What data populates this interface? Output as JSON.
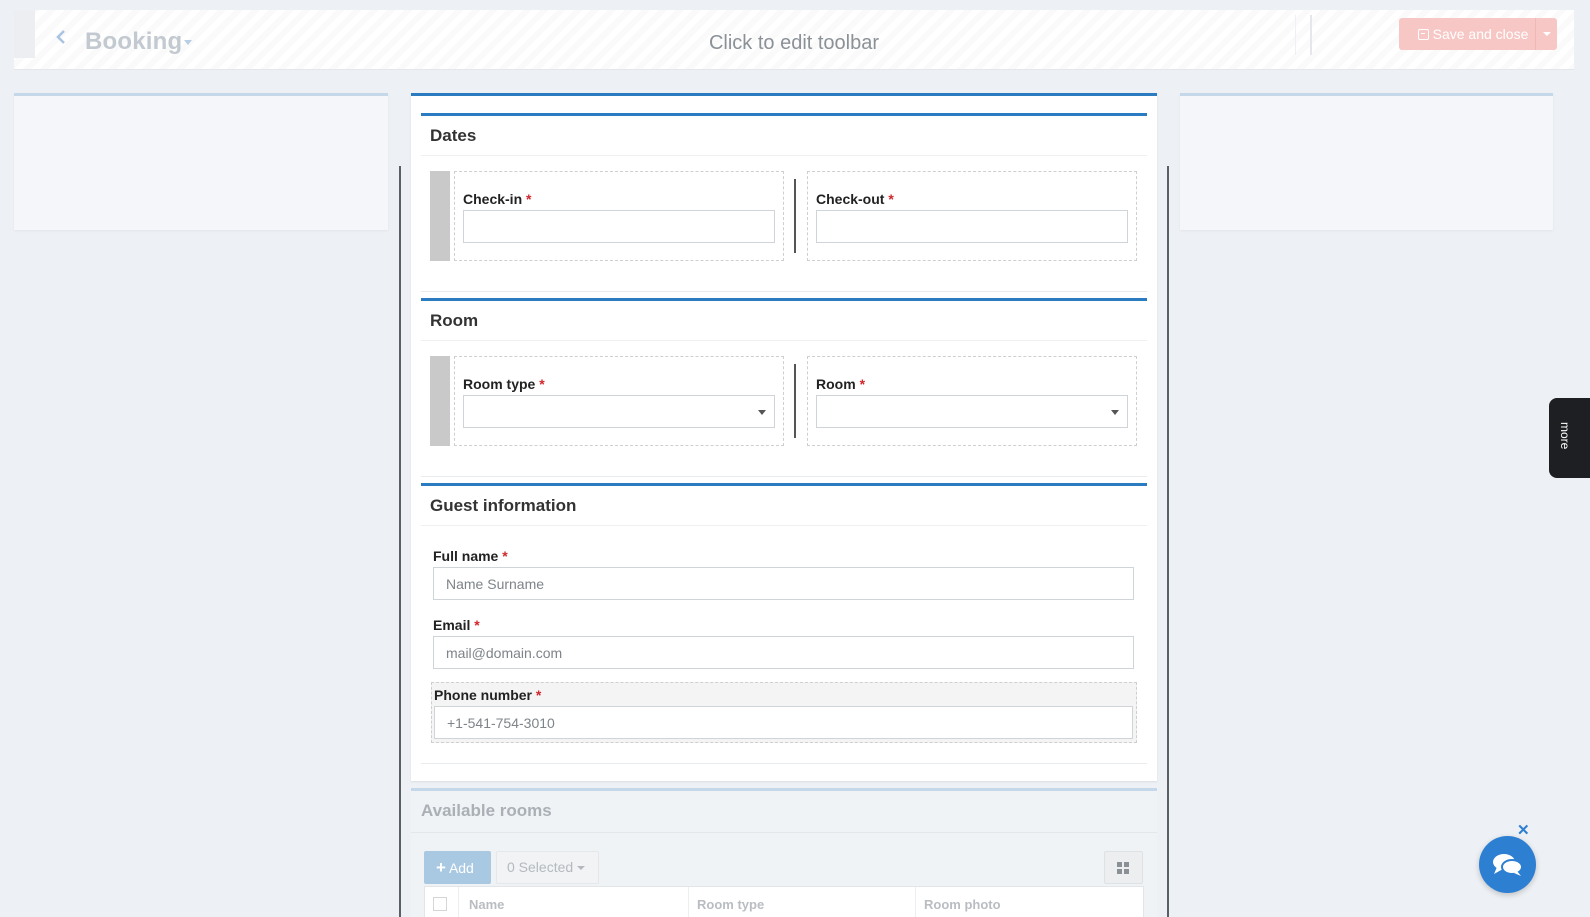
{
  "toolbar": {
    "title": "Booking",
    "center_text": "Click to edit toolbar",
    "save_label": "Save and close"
  },
  "sections": {
    "dates": {
      "title": "Dates",
      "checkin_label": "Check-in",
      "checkout_label": "Check-out",
      "checkin_value": "",
      "checkout_value": ""
    },
    "room": {
      "title": "Room",
      "room_type_label": "Room type",
      "room_label": "Room",
      "room_type_value": "",
      "room_value": ""
    },
    "guest": {
      "title": "Guest information",
      "full_name_label": "Full name",
      "full_name_placeholder": "Name Surname",
      "email_label": "Email",
      "email_placeholder": "mail@domain.com",
      "phone_label": "Phone number",
      "phone_placeholder": "+1-541-754-3010"
    },
    "available_rooms": {
      "title": "Available rooms",
      "add_label": "Add",
      "selected_label": "0 Selected",
      "columns": [
        "Name",
        "Room type",
        "Room photo"
      ]
    }
  },
  "required_marker": "*",
  "more_tab": "more",
  "icons": {
    "back": "chevron-left-icon",
    "save": "floppy-disk-icon",
    "chat": "chat-bubbles-icon",
    "close": "close-icon",
    "grid": "grid-icon"
  },
  "colors": {
    "accent": "#2b7bc0",
    "save_button": "#f6c7c4",
    "required": "#d0262c",
    "chat": "#2d7fd2"
  }
}
